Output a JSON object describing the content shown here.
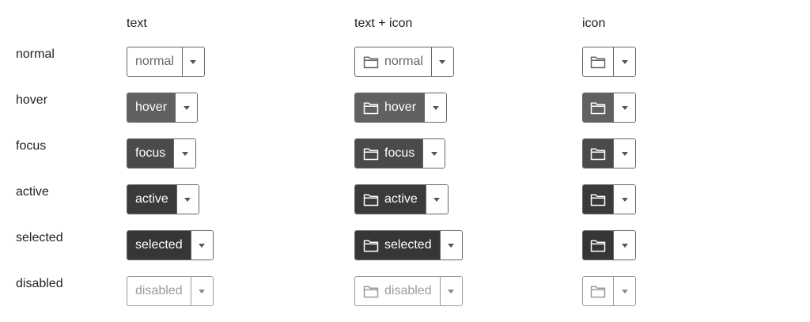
{
  "columns": [
    "text",
    "text + icon",
    "icon"
  ],
  "rows": [
    {
      "state": "normal",
      "label": "normal"
    },
    {
      "state": "hover",
      "label": "hover"
    },
    {
      "state": "focus",
      "label": "focus"
    },
    {
      "state": "active",
      "label": "active"
    },
    {
      "state": "selected",
      "label": "selected"
    },
    {
      "state": "disabled",
      "label": "disabled"
    }
  ],
  "icons": {
    "main": "folder-icon",
    "dropdown": "caret-down-icon"
  },
  "colors": {
    "border": "#666666",
    "normal_text": "#666666",
    "hover_bg": "#616161",
    "focus_bg": "#4a4a4a",
    "active_bg": "#3a3a3a",
    "selected_bg": "#363636",
    "disabled": "#9a9a9a"
  }
}
